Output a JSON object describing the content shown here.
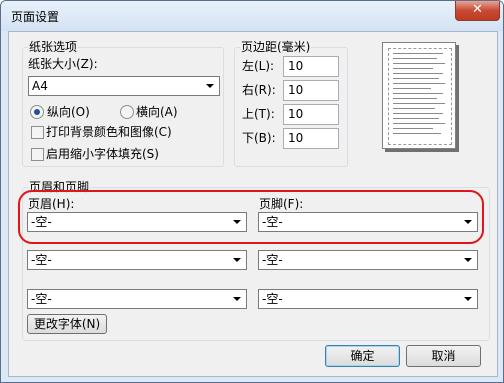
{
  "window": {
    "title": "页面设置",
    "close_glyph": "✕"
  },
  "paper": {
    "group_label": "纸张选项",
    "size_label": "纸张大小(Z):",
    "size_value": "A4",
    "portrait_label": "纵向(O)",
    "landscape_label": "横向(A)",
    "orientation_selected": "portrait",
    "print_background_label": "打印背景颜色和图像(C)",
    "print_background_checked": false,
    "shrink_to_fit_label": "启用缩小字体填充(S)",
    "shrink_to_fit_checked": false
  },
  "margins": {
    "group_label": "页边距(毫米)",
    "left_label": "左(L):",
    "left_value": "10",
    "right_label": "右(R):",
    "right_value": "10",
    "top_label": "上(T):",
    "top_value": "10",
    "bottom_label": "下(B):",
    "bottom_value": "10"
  },
  "header_footer": {
    "group_label": "页眉和页脚",
    "header_label": "页眉(H):",
    "footer_label": "页脚(F):",
    "left_header": "-空-",
    "left_footer": "-空-",
    "center_header": "-空-",
    "center_footer": "-空-",
    "right_header": "-空-",
    "right_footer": "-空-",
    "change_font_label": "更改字体(N)"
  },
  "buttons": {
    "ok": "确定",
    "cancel": "取消"
  },
  "colors": {
    "highlight": "#e0151a",
    "title_bar": "#dbe8f6",
    "close_button": "#c84a34"
  }
}
